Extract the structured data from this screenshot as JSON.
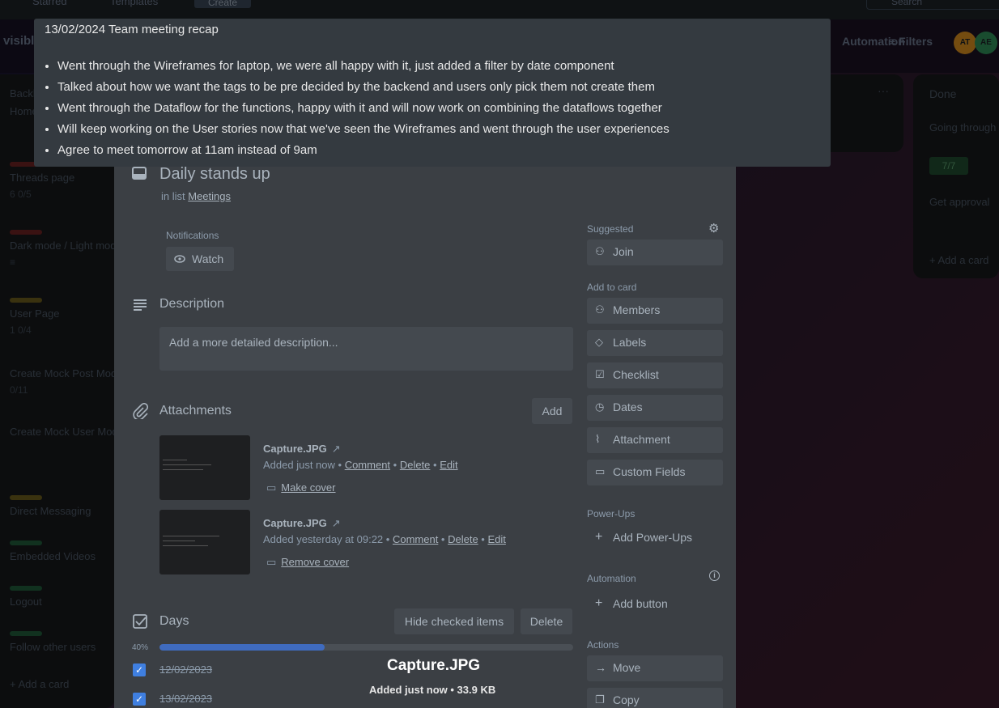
{
  "topbar": {
    "starred": "Starred",
    "templates": "Templates",
    "create": "Create",
    "search": "Search"
  },
  "boardbar": {
    "visibility": "visible",
    "automation": "Automation",
    "filters": "Filters",
    "avatars": [
      "AT",
      "AE"
    ]
  },
  "lists": {
    "left_cards": [
      {
        "title": "Home page",
        "color": "",
        "meta": ""
      },
      {
        "title": "Threads page",
        "color": "#b33",
        "meta": "6   0/5"
      },
      {
        "title": "Dark mode / Light mode",
        "color": "#b33",
        "meta": "≡"
      },
      {
        "title": "User Page",
        "color": "#b8a02e",
        "meta": "1   0/4"
      },
      {
        "title": "Create Mock Post Model",
        "color": "",
        "meta": "0/11"
      },
      {
        "title": "Create Mock User Model",
        "color": "",
        "meta": ""
      },
      {
        "title": "Direct Messaging",
        "color": "#b8a02e",
        "meta": ""
      },
      {
        "title": "Embedded Videos",
        "color": "#2e8b57",
        "meta": ""
      },
      {
        "title": "Logout",
        "color": "#2e8b57",
        "meta": ""
      },
      {
        "title": "Follow other users",
        "color": "#2e8b57",
        "meta": ""
      }
    ],
    "left_header": "Backlog",
    "add_card": "Add a card",
    "done_title": "Done",
    "done_cards": [
      "Going through meeting agenda",
      "Get approval"
    ],
    "done_badge": "7/7"
  },
  "tooltip": {
    "title": "13/02/2024 Team meeting recap",
    "items": [
      "Went through the Wireframes for laptop, we were all happy with it, just added a filter by date component",
      "Talked about how we want the tags to be pre decided by the backend and users only pick them not create them",
      "Went through the Dataflow for the functions, happy with it and will now work on combining the dataflows together",
      "Will keep working on the User stories now that we've seen the Wireframes and went through the user experiences",
      "Agree to meet tomorrow at 11am instead of 9am"
    ]
  },
  "modal": {
    "title": "Daily stands up",
    "in_list_prefix": "in list",
    "list_name": "Meetings",
    "notifications_label": "Notifications",
    "watch_label": "Watch",
    "description_title": "Description",
    "description_placeholder": "Add a more detailed description...",
    "attachments_title": "Attachments",
    "attachments_add": "Add",
    "attachments": [
      {
        "name": "Capture.JPG",
        "added": "Added just now",
        "comment": "Comment",
        "delete": "Delete",
        "edit": "Edit",
        "cover_action": "Make cover"
      },
      {
        "name": "Capture.JPG",
        "added": "Added yesterday at 09:22",
        "comment": "Comment",
        "delete": "Delete",
        "edit": "Edit",
        "cover_action": "Remove cover"
      }
    ],
    "checklist_title": "Days",
    "hide_checked": "Hide checked items",
    "delete_label": "Delete",
    "progress_percent": 40,
    "progress_text": "40%",
    "checklist_items": [
      {
        "label": "12/02/2023",
        "checked": true
      },
      {
        "label": "13/02/2023",
        "checked": true
      }
    ]
  },
  "sidebar": {
    "suggested_label": "Suggested",
    "join": "Join",
    "add_to_card_label": "Add to card",
    "add_to_card": [
      "Members",
      "Labels",
      "Checklist",
      "Dates",
      "Attachment",
      "Custom Fields"
    ],
    "powerups_label": "Power-Ups",
    "add_powerups": "Add Power-Ups",
    "automation_label": "Automation",
    "add_button": "Add button",
    "actions_label": "Actions",
    "actions": [
      "Move",
      "Copy"
    ]
  },
  "preview_caption": {
    "name": "Capture.JPG",
    "details": "Added just now • 33.9 KB"
  }
}
